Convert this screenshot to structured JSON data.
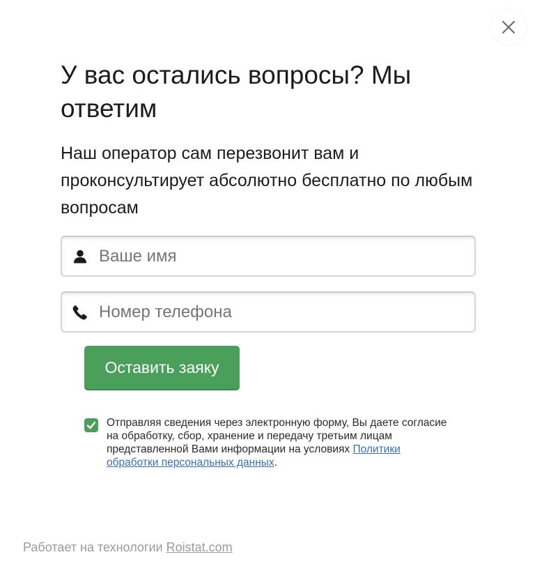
{
  "modal": {
    "title": "У вас остались вопросы? Мы ответим",
    "subtitle": "Наш оператор сам перезвонит вам и проконсультирует абсолютно бесплатно по любым вопросам",
    "close_icon": "close-icon"
  },
  "form": {
    "name": {
      "icon": "user-icon",
      "value": "",
      "placeholder": "Ваше имя"
    },
    "phone": {
      "icon": "phone-icon",
      "value": "",
      "placeholder": "Номер телефона"
    },
    "submit_label": "Оставить заяку",
    "accent_color": "#4a9f5b"
  },
  "consent": {
    "checked": true,
    "text": "Отправляя сведения через электронную форму, Вы даете согласие на обработку, сбор, хранение и передачу третьим лицам представленной Вами информации на условиях ",
    "link_text": "Политики обработки персональных данных",
    "suffix": "."
  },
  "footer": {
    "text": "Работает на технологии ",
    "link_text": "Roistat.com"
  }
}
